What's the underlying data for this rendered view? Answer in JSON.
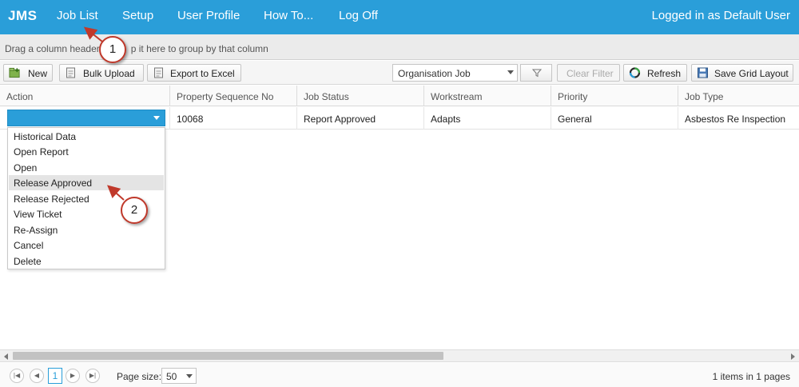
{
  "nav": {
    "brand": "JMS",
    "items": [
      "Job List",
      "Setup",
      "User Profile",
      "How To...",
      "Log Off"
    ],
    "user_text": "Logged in as Default User"
  },
  "group_panel": {
    "text_before": "Drag a column header",
    "text_after": "p it here to group by that column"
  },
  "toolbar": {
    "new_label": "New",
    "bulk_upload_label": "Bulk Upload",
    "export_label": "Export to Excel",
    "view_select_value": "Organisation Job",
    "clear_filter_label": "Clear Filter",
    "refresh_label": "Refresh",
    "save_layout_label": "Save Grid Layout"
  },
  "grid": {
    "columns": [
      "Action",
      "Property Sequence No",
      "Job Status",
      "Workstream",
      "Priority",
      "Job Type"
    ],
    "rows": [
      [
        "",
        "10068",
        "Report Approved",
        "Adapts",
        "General",
        "Asbestos Re Inspection"
      ]
    ]
  },
  "action_menu": {
    "items": [
      "Historical Data",
      "Open Report",
      "Open",
      "Release Approved",
      "Release Rejected",
      "View Ticket",
      "Re-Assign",
      "Cancel",
      "Delete"
    ],
    "highlighted": "Release Approved"
  },
  "callouts": [
    "1",
    "2"
  ],
  "pager": {
    "current_page": "1",
    "page_size_label": "Page size:",
    "page_size_value": "50",
    "info_count": "1",
    "info_mid": " items in ",
    "info_pages": "1",
    "info_suffix": " pages"
  },
  "colors": {
    "nav_bg": "#2a9ed9",
    "callout_border": "#c0392b",
    "row_hover": "#e4e4e4"
  }
}
